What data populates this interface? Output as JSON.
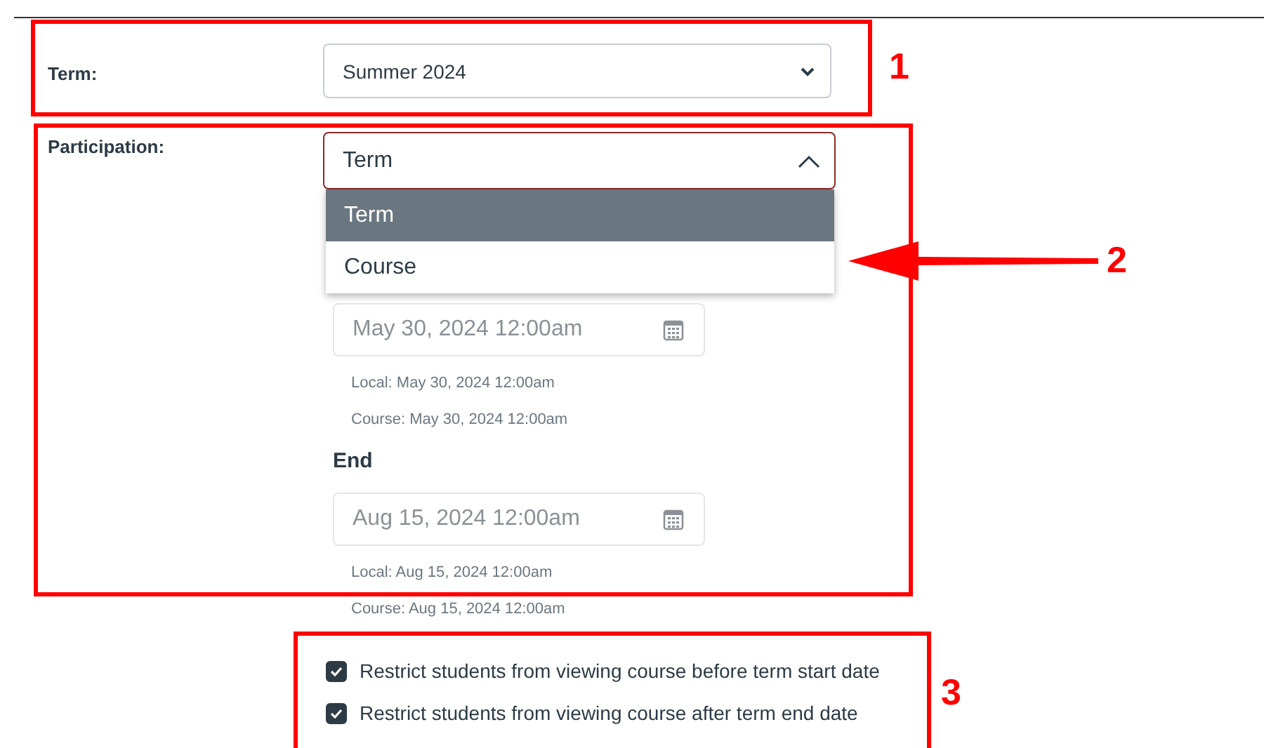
{
  "term": {
    "label": "Term:",
    "value": "Summer 2024"
  },
  "participation": {
    "label": "Participation:",
    "value": "Term",
    "expanded": true,
    "options": [
      {
        "label": "Term",
        "selected": true
      },
      {
        "label": "Course",
        "selected": false
      }
    ],
    "start": {
      "value": "May 30, 2024 12:00am",
      "disabled": true,
      "local": "Local: May 30, 2024 12:00am",
      "course": "Course: May 30, 2024 12:00am"
    },
    "end": {
      "label": "End",
      "value": "Aug 15, 2024 12:00am",
      "disabled": true,
      "local": "Local: Aug 15, 2024 12:00am",
      "course": "Course: Aug 15, 2024 12:00am"
    }
  },
  "restrictions": [
    {
      "label": "Restrict students from viewing course before term start date",
      "checked": true
    },
    {
      "label": "Restrict students from viewing course after term end date",
      "checked": true
    }
  ],
  "annotations": [
    {
      "label": "1",
      "arrow": false
    },
    {
      "label": "2",
      "arrow": true
    },
    {
      "label": "3",
      "arrow": false
    }
  ]
}
